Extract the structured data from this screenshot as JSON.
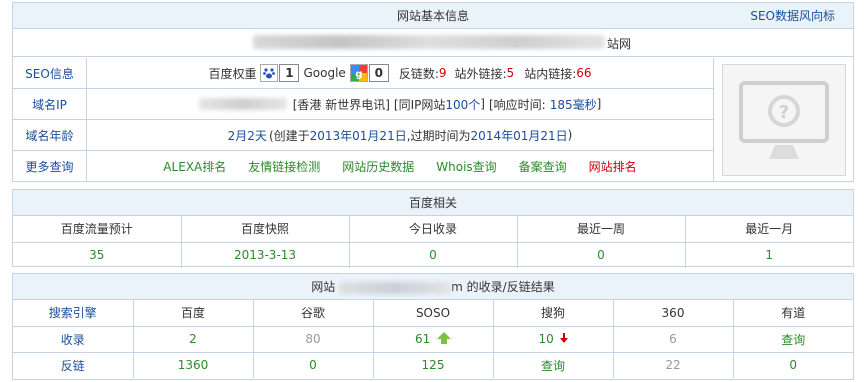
{
  "info_panel": {
    "title": "网站基本信息",
    "seo_link": "SEO数据风向标",
    "domain_suffix": "站网",
    "seo": {
      "label": "SEO信息",
      "baidu_weight_label": "百度权重",
      "baidu_weight": "1",
      "google_label": "Google",
      "google_pr": "0",
      "backlinks_label": "反链数:",
      "backlinks": "9",
      "external_label": "站外链接:",
      "external": "5",
      "internal_label": "站内链接:",
      "internal": "66"
    },
    "ip": {
      "label": "域名IP",
      "location": "[香港 新世界电讯]",
      "same_ip_prefix": "[同IP网站",
      "same_ip_count": "100个",
      "same_ip_suffix": "]",
      "resp_prefix": "[响应时间:",
      "resp_time": "185毫秒",
      "resp_suffix": "]"
    },
    "age": {
      "label": "域名年龄",
      "age": "2月2天",
      "created_prefix": "(创建于",
      "created": "2013年01月21日",
      "expire_prefix": ",过期时间为",
      "expire": "2014年01月21日",
      "suffix": ")"
    },
    "more": {
      "label": "更多查询",
      "links": [
        "ALEXA排名",
        "友情链接检测",
        "网站历史数据",
        "Whois查询",
        "备案查询",
        "网站排名"
      ]
    }
  },
  "baidu_panel": {
    "title": "百度相关",
    "headers": [
      "百度流量预计",
      "百度快照",
      "今日收录",
      "最近一周",
      "最近一月"
    ],
    "values": [
      "35",
      "2013-3-13",
      "0",
      "0",
      "1"
    ]
  },
  "engine_panel": {
    "title_prefix": "网站",
    "title_mid": "m",
    "title_suffix": "的收录/反链结果",
    "headers": [
      "搜索引擎",
      "百度",
      "谷歌",
      "SOSO",
      "搜狗",
      "360",
      "有道"
    ],
    "index_label": "收录",
    "index_values": [
      "2",
      "80",
      "61",
      "10",
      "6",
      "查询"
    ],
    "backlink_label": "反链",
    "backlink_values": [
      "1360",
      "0",
      "125",
      "查询",
      "22",
      "0"
    ]
  },
  "colors": {
    "accent": "#1a4d9c",
    "header_bg": "#eaf2fa",
    "border": "#c6d4e1",
    "red": "#cc0000",
    "green": "#2b8a2b"
  }
}
